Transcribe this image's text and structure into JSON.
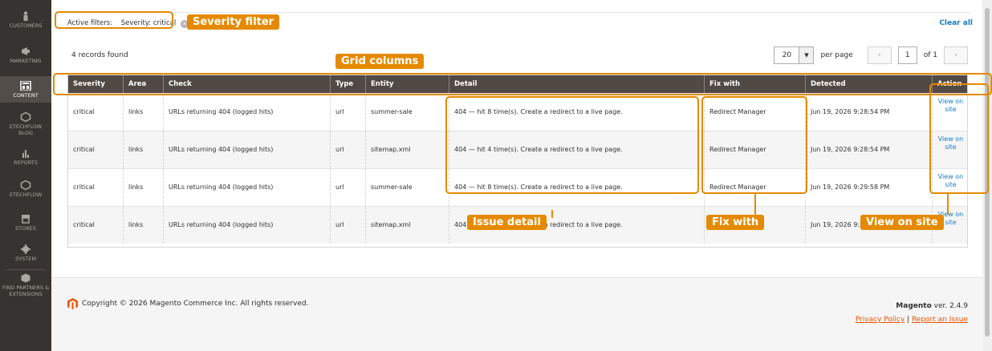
{
  "sidebar": {
    "items": [
      {
        "label": "Customers"
      },
      {
        "label": "Marketing"
      },
      {
        "label": "Content"
      },
      {
        "label": "Etechflow Blog"
      },
      {
        "label": "Reports"
      },
      {
        "label": "Etechflow"
      },
      {
        "label": "Stores"
      },
      {
        "label": "System"
      },
      {
        "label": "Find Partners & Extensions"
      }
    ]
  },
  "filters": {
    "label": "Active filters:",
    "value": "Severity: critical",
    "clear": "Clear all"
  },
  "toolbar": {
    "records": "4 records found",
    "per_page_value": "20",
    "per_page_label": "per page",
    "page": "1",
    "of": "of 1",
    "prev_icon": "chevron-left-icon",
    "next_icon": "chevron-right-icon"
  },
  "grid": {
    "columns": [
      "Severity",
      "Area",
      "Check",
      "Type",
      "Entity",
      "Detail",
      "Fix with",
      "Detected",
      "Action"
    ],
    "rows": [
      {
        "severity": "critical",
        "area": "links",
        "check": "URLs returning 404 (logged hits)",
        "type": "url",
        "entity": "summer-sale",
        "detail": "404 — hit 8 time(s). Create a redirect to a live page.",
        "fix": "Redirect Manager",
        "detected": "Jun 19, 2026 9:28:54 PM",
        "action": "View on site"
      },
      {
        "severity": "critical",
        "area": "links",
        "check": "URLs returning 404 (logged hits)",
        "type": "url",
        "entity": "sitemap.xml",
        "detail": "404 — hit 4 time(s). Create a redirect to a live page.",
        "fix": "Redirect Manager",
        "detected": "Jun 19, 2026 9:28:54 PM",
        "action": "View on site"
      },
      {
        "severity": "critical",
        "area": "links",
        "check": "URLs returning 404 (logged hits)",
        "type": "url",
        "entity": "summer-sale",
        "detail": "404 — hit 8 time(s). Create a redirect to a live page.",
        "fix": "Redirect Manager",
        "detected": "Jun 19, 2026 9:29:58 PM",
        "action": "View on site"
      },
      {
        "severity": "critical",
        "area": "links",
        "check": "URLs returning 404 (logged hits)",
        "type": "url",
        "entity": "sitemap.xml",
        "detail": "404 — hit 4 time(s). Create a redirect to a live page.",
        "fix": "",
        "detected": "Jun 19, 2026 9:29:58 PM",
        "action": "View on site"
      }
    ]
  },
  "footer": {
    "copyright": "Copyright © 2026 Magento Commerce Inc. All rights reserved.",
    "brand": "Magento",
    "version": " ver. 2.4.9",
    "privacy": "Privacy Policy",
    "separator": " | ",
    "report": "Report an Issue"
  },
  "annotations": {
    "severity_filter": "Severity filter",
    "grid_columns": "Grid columns",
    "issue_detail": "Issue detail",
    "fix_with": "Fix with",
    "view_on_site": "View on site"
  },
  "colors": {
    "accent": "#e58a00",
    "header": "#514943",
    "link": "#1979c3",
    "sidebar": "#373330"
  }
}
